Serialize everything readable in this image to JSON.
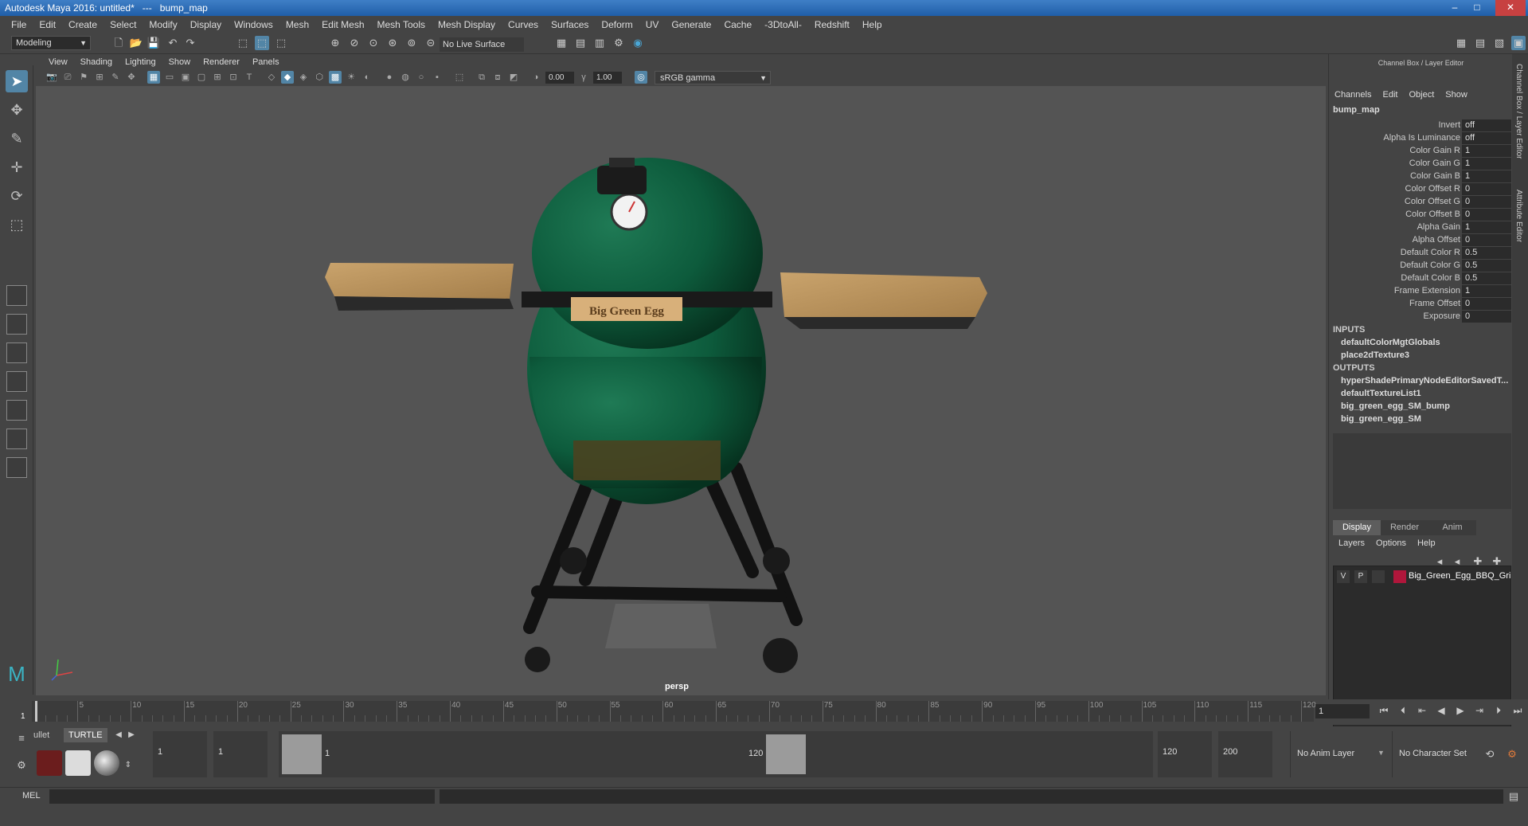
{
  "window": {
    "title": "Autodesk Maya 2016: untitled*   ---   bump_map",
    "minimize": "–",
    "maximize": "□",
    "close": "✕"
  },
  "menus": [
    "File",
    "Edit",
    "Create",
    "Select",
    "Modify",
    "Display",
    "Windows",
    "Mesh",
    "Edit Mesh",
    "Mesh Tools",
    "Mesh Display",
    "Curves",
    "Surfaces",
    "Deform",
    "UV",
    "Generate",
    "Cache",
    "-3DtoAll-",
    "Redshift",
    "Help"
  ],
  "status_line": {
    "mode": "Modeling",
    "live_surface": "No Live Surface"
  },
  "panel_menu": [
    "View",
    "Shading",
    "Lighting",
    "Show",
    "Renderer",
    "Panels"
  ],
  "view_toolbar": {
    "exposure": "0.00",
    "gamma": "1.00",
    "color_space": "sRGB gamma"
  },
  "viewport": {
    "camera": "persp",
    "model_label": "Big Green Egg"
  },
  "channel_box": {
    "header": "Channel Box / Layer Editor",
    "menu": [
      "Channels",
      "Edit",
      "Object",
      "Show"
    ],
    "node": "bump_map",
    "attributes": [
      {
        "label": "Invert",
        "value": "off"
      },
      {
        "label": "Alpha Is Luminance",
        "value": "off"
      },
      {
        "label": "Color Gain R",
        "value": "1"
      },
      {
        "label": "Color Gain G",
        "value": "1"
      },
      {
        "label": "Color Gain B",
        "value": "1"
      },
      {
        "label": "Color Offset R",
        "value": "0"
      },
      {
        "label": "Color Offset G",
        "value": "0"
      },
      {
        "label": "Color Offset B",
        "value": "0"
      },
      {
        "label": "Alpha Gain",
        "value": "1"
      },
      {
        "label": "Alpha Offset",
        "value": "0"
      },
      {
        "label": "Default Color R",
        "value": "0.5"
      },
      {
        "label": "Default Color G",
        "value": "0.5"
      },
      {
        "label": "Default Color B",
        "value": "0.5"
      },
      {
        "label": "Frame Extension",
        "value": "1"
      },
      {
        "label": "Frame Offset",
        "value": "0"
      },
      {
        "label": "Exposure",
        "value": "0"
      }
    ],
    "inputs_label": "INPUTS",
    "inputs": [
      "defaultColorMgtGlobals",
      "place2dTexture3"
    ],
    "outputs_label": "OUTPUTS",
    "outputs": [
      "hyperShadePrimaryNodeEditorSavedT...",
      "defaultTextureList1",
      "big_green_egg_SM_bump",
      "big_green_egg_SM"
    ]
  },
  "layer_editor": {
    "tabs": [
      "Display",
      "Render",
      "Anim"
    ],
    "menu": [
      "Layers",
      "Options",
      "Help"
    ],
    "layer": {
      "v": "V",
      "p": "P",
      "name": "Big_Green_Egg_BBQ_Gri",
      "color": "#b0163b"
    }
  },
  "side_tabs": [
    "Channel Box / Layer Editor",
    "Attribute Editor"
  ],
  "time_slider": {
    "ticks": [
      "5",
      "10",
      "15",
      "20",
      "25",
      "30",
      "35",
      "40",
      "45",
      "50",
      "55",
      "60",
      "65",
      "70",
      "75",
      "80",
      "85",
      "90",
      "95",
      "100",
      "105",
      "110",
      "115",
      "120"
    ],
    "start_label": "1",
    "current_frame": "1"
  },
  "shelf": {
    "tabs": [
      "ullet",
      "TURTLE"
    ]
  },
  "range": {
    "start": "1",
    "inner_start": "1",
    "handle_start": "1",
    "handle_end": "120",
    "end": "120",
    "anim_end": "200",
    "anim_layer": "No Anim Layer",
    "character_set": "No Character Set"
  },
  "command": {
    "mel_label": "MEL"
  }
}
